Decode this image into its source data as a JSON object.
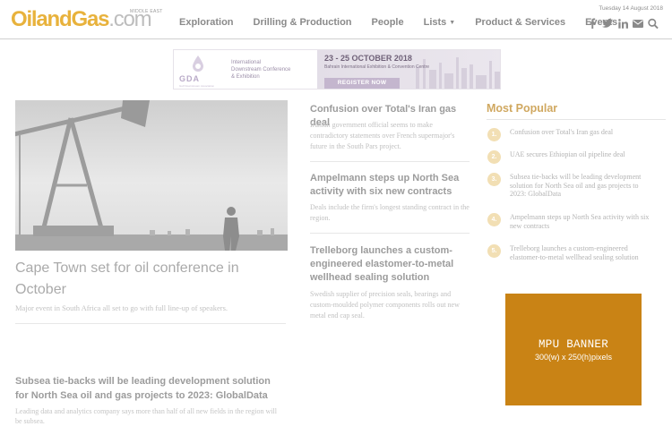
{
  "site": {
    "logo_part1": "Oiland",
    "logo_part2": "Gas",
    "logo_part3": ".com",
    "logo_region": "MIDDLE EAST",
    "date": "Tuesday 14 August 2018"
  },
  "nav": {
    "items": [
      "Exploration",
      "Drilling & Production",
      "People",
      "Lists",
      "Product & Services",
      "Events"
    ],
    "lists_has_dropdown": true
  },
  "social": {
    "icons": [
      "facebook-icon",
      "twitter-icon",
      "linkedin-icon",
      "email-icon",
      "search-icon"
    ]
  },
  "banner_ad": {
    "logo_text": "GDA",
    "logo_sub": "Gulf Downstream Association",
    "title_line1": "International",
    "title_line2": "Downstream Conference",
    "title_line3": "& Exhibition",
    "dates": "23 - 25 OCTOBER 2018",
    "venue": "Bahrain International Exhibition & Convention Centre",
    "cta": "REGISTER NOW"
  },
  "feature": {
    "title": "Cape Town set for oil conference in October",
    "summary": "Major event in South Africa all set to go with full line-up of speakers."
  },
  "middle_articles": [
    {
      "title": "Confusion over Total's Iran gas deal",
      "summary": "Iranian government official seems to make contradictory statements over French supermajor's future in the South Pars project."
    },
    {
      "title": "Ampelmann steps up North Sea activity with six new contracts",
      "summary": "Deals include the firm's longest standing contract in the region."
    },
    {
      "title": "Trelleborg launches a custom-engineered elastomer-to-metal wellhead sealing solution",
      "summary": "Swedish supplier of precision seals, bearings and custom-moulded polymer components rolls out new metal end cap seal."
    }
  ],
  "bottom_article": {
    "title": "Subsea tie-backs will be leading development solution for North Sea oil and gas projects to 2023: GlobalData",
    "summary": "Leading data and analytics company says more than half of all new fields in the region will be subsea."
  },
  "most_popular": {
    "heading": "Most Popular",
    "items": [
      {
        "num": "1.",
        "text": "Confusion over Total's Iran gas deal"
      },
      {
        "num": "2.",
        "text": "UAE secures Ethiopian oil pipeline deal"
      },
      {
        "num": "3.",
        "text": "Subsea tie-backs will be leading development solution for North Sea oil and gas projects to 2023: GlobalData"
      },
      {
        "num": "4.",
        "text": "Ampelmann steps up North Sea activity with six new contracts"
      },
      {
        "num": "5.",
        "text": "Trelleborg launches a custom-engineered elastomer-to-metal wellhead sealing solution"
      }
    ]
  },
  "mpu": {
    "title": "MPU BANNER",
    "subtitle": "300(w) x 250(h)pixels"
  },
  "colors": {
    "accent": "#e8b23c",
    "mpu_bg": "#c98315",
    "popular_number": "#f2dfb4"
  }
}
